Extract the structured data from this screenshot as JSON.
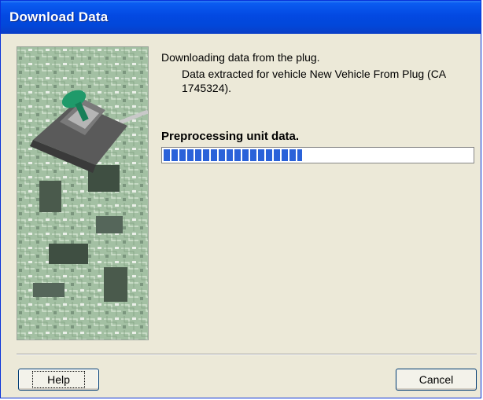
{
  "window": {
    "title": "Download Data"
  },
  "content": {
    "message_line1": "Downloading data from the plug.",
    "message_line2": "Data extracted for vehicle New Vehicle From Plug (CA 1745324).",
    "status": "Preprocessing unit data.",
    "progress_fraction": 0.45
  },
  "buttons": {
    "help": "Help",
    "cancel": "Cancel"
  },
  "icons": {
    "side_image": "circuit-board-plug-image"
  },
  "colors": {
    "title_bar": "#0247d9",
    "progress": "#2a62d9",
    "dialog_bg": "#ece9d8"
  }
}
